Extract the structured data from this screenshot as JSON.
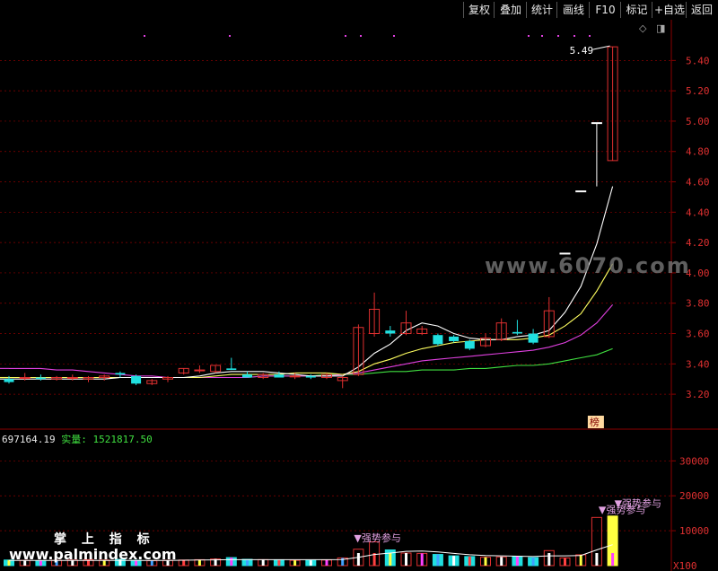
{
  "toolbar": {
    "items": [
      "复权",
      "叠加",
      "统计",
      "画线",
      "F10",
      "标记",
      "+自选",
      "返回"
    ]
  },
  "price_axis": {
    "labels": [
      "5.40",
      "5.20",
      "5.00",
      "4.80",
      "4.60",
      "4.40",
      "4.20",
      "4.00",
      "3.80",
      "3.60",
      "3.40",
      "3.20"
    ],
    "values": [
      5.4,
      5.2,
      5.0,
      4.8,
      4.6,
      4.4,
      4.2,
      4.0,
      3.8,
      3.6,
      3.4,
      3.2
    ]
  },
  "volume_axis": {
    "labels": [
      "30000",
      "20000",
      "10000"
    ],
    "values": [
      30000,
      20000,
      10000
    ],
    "unit_label": "X100"
  },
  "annotations": {
    "high_price": "5.49",
    "rank_tag": "榜",
    "signal_text": "强势参与"
  },
  "volume_header": {
    "value": "697164.19",
    "actual_label": "实量:",
    "actual_value": "1521817.50"
  },
  "watermarks": {
    "site": "www.6070.com",
    "brand": "掌 上 指 标",
    "url": "www.palmindex.com"
  },
  "colors": {
    "up": "#e03030",
    "down": "#20e0e0",
    "ma5": "#ffffff",
    "ma10": "#ffff60",
    "ma20": "#e040e0",
    "ma60": "#40e040",
    "grid": "#8b0000"
  },
  "chart_data": {
    "type": "candlestick",
    "price_ylim": [
      3.1,
      5.55
    ],
    "volume_ylim": [
      0,
      36000
    ],
    "candles": [
      {
        "o": 3.3,
        "h": 3.32,
        "l": 3.27,
        "c": 3.28
      },
      {
        "o": 3.31,
        "h": 3.34,
        "l": 3.29,
        "c": 3.31
      },
      {
        "o": 3.31,
        "h": 3.33,
        "l": 3.29,
        "c": 3.3
      },
      {
        "o": 3.3,
        "h": 3.32,
        "l": 3.29,
        "c": 3.31
      },
      {
        "o": 3.31,
        "h": 3.33,
        "l": 3.29,
        "c": 3.31
      },
      {
        "o": 3.3,
        "h": 3.32,
        "l": 3.28,
        "c": 3.31
      },
      {
        "o": 3.31,
        "h": 3.33,
        "l": 3.29,
        "c": 3.32
      },
      {
        "o": 3.34,
        "h": 3.35,
        "l": 3.31,
        "c": 3.33
      },
      {
        "o": 3.32,
        "h": 3.33,
        "l": 3.26,
        "c": 3.27
      },
      {
        "o": 3.27,
        "h": 3.3,
        "l": 3.26,
        "c": 3.29
      },
      {
        "o": 3.3,
        "h": 3.32,
        "l": 3.28,
        "c": 3.31
      },
      {
        "o": 3.34,
        "h": 3.37,
        "l": 3.33,
        "c": 3.37
      },
      {
        "o": 3.36,
        "h": 3.39,
        "l": 3.34,
        "c": 3.36
      },
      {
        "o": 3.35,
        "h": 3.39,
        "l": 3.34,
        "c": 3.39
      },
      {
        "o": 3.37,
        "h": 3.44,
        "l": 3.36,
        "c": 3.36
      },
      {
        "o": 3.33,
        "h": 3.35,
        "l": 3.31,
        "c": 3.31
      },
      {
        "o": 3.31,
        "h": 3.34,
        "l": 3.3,
        "c": 3.33
      },
      {
        "o": 3.33,
        "h": 3.35,
        "l": 3.31,
        "c": 3.31
      },
      {
        "o": 3.32,
        "h": 3.34,
        "l": 3.3,
        "c": 3.32
      },
      {
        "o": 3.32,
        "h": 3.33,
        "l": 3.3,
        "c": 3.31
      },
      {
        "o": 3.31,
        "h": 3.34,
        "l": 3.3,
        "c": 3.33
      },
      {
        "o": 3.29,
        "h": 3.32,
        "l": 3.24,
        "c": 3.31
      },
      {
        "o": 3.33,
        "h": 3.66,
        "l": 3.32,
        "c": 3.64
      },
      {
        "o": 3.6,
        "h": 3.87,
        "l": 3.58,
        "c": 3.76
      },
      {
        "o": 3.62,
        "h": 3.65,
        "l": 3.58,
        "c": 3.6
      },
      {
        "o": 3.6,
        "h": 3.75,
        "l": 3.59,
        "c": 3.67
      },
      {
        "o": 3.6,
        "h": 3.65,
        "l": 3.59,
        "c": 3.63
      },
      {
        "o": 3.59,
        "h": 3.6,
        "l": 3.52,
        "c": 3.53
      },
      {
        "o": 3.58,
        "h": 3.59,
        "l": 3.54,
        "c": 3.55
      },
      {
        "o": 3.55,
        "h": 3.56,
        "l": 3.49,
        "c": 3.5
      },
      {
        "o": 3.52,
        "h": 3.6,
        "l": 3.51,
        "c": 3.57
      },
      {
        "o": 3.56,
        "h": 3.7,
        "l": 3.55,
        "c": 3.67
      },
      {
        "o": 3.61,
        "h": 3.69,
        "l": 3.59,
        "c": 3.6
      },
      {
        "o": 3.6,
        "h": 3.63,
        "l": 3.53,
        "c": 3.54
      },
      {
        "o": 3.58,
        "h": 3.84,
        "l": 3.57,
        "c": 3.75
      },
      {
        "o": 4.13,
        "h": 4.13,
        "l": 4.13,
        "c": 4.13
      },
      {
        "o": 4.54,
        "h": 4.54,
        "l": 4.54,
        "c": 4.54
      },
      {
        "o": 4.99,
        "h": 4.99,
        "l": 4.57,
        "c": 4.99
      },
      {
        "o": 4.74,
        "h": 5.49,
        "l": 4.74,
        "c": 5.49
      }
    ],
    "ma5": [
      3.3,
      3.3,
      3.3,
      3.3,
      3.3,
      3.3,
      3.3,
      3.31,
      3.31,
      3.31,
      3.31,
      3.31,
      3.32,
      3.34,
      3.35,
      3.35,
      3.35,
      3.34,
      3.33,
      3.32,
      3.32,
      3.32,
      3.38,
      3.47,
      3.53,
      3.62,
      3.67,
      3.65,
      3.6,
      3.57,
      3.56,
      3.56,
      3.58,
      3.59,
      3.62,
      3.74,
      3.91,
      4.19,
      4.57
    ],
    "ma10": [
      3.31,
      3.31,
      3.31,
      3.31,
      3.31,
      3.31,
      3.31,
      3.31,
      3.31,
      3.31,
      3.31,
      3.31,
      3.31,
      3.32,
      3.33,
      3.33,
      3.33,
      3.33,
      3.34,
      3.34,
      3.34,
      3.33,
      3.35,
      3.4,
      3.43,
      3.47,
      3.5,
      3.52,
      3.54,
      3.55,
      3.56,
      3.56,
      3.56,
      3.57,
      3.59,
      3.65,
      3.73,
      3.88,
      4.06
    ],
    "ma20": [
      3.37,
      3.37,
      3.37,
      3.36,
      3.36,
      3.35,
      3.34,
      3.33,
      3.32,
      3.32,
      3.31,
      3.31,
      3.31,
      3.31,
      3.31,
      3.31,
      3.32,
      3.32,
      3.32,
      3.32,
      3.32,
      3.33,
      3.34,
      3.36,
      3.38,
      3.4,
      3.42,
      3.43,
      3.44,
      3.45,
      3.46,
      3.47,
      3.48,
      3.49,
      3.51,
      3.54,
      3.59,
      3.67,
      3.79
    ],
    "ma60": [
      3.31,
      3.31,
      3.31,
      3.31,
      3.31,
      3.31,
      3.31,
      3.31,
      3.31,
      3.31,
      3.31,
      3.31,
      3.31,
      3.31,
      3.31,
      3.31,
      3.32,
      3.32,
      3.32,
      3.32,
      3.33,
      3.33,
      3.33,
      3.34,
      3.35,
      3.35,
      3.36,
      3.36,
      3.36,
      3.37,
      3.37,
      3.38,
      3.39,
      3.39,
      3.4,
      3.42,
      3.44,
      3.46,
      3.5
    ],
    "volume": [
      1600,
      1500,
      1400,
      1500,
      1600,
      1700,
      1600,
      1800,
      1500,
      1400,
      1500,
      1600,
      1700,
      1900,
      2300,
      1800,
      1700,
      1600,
      1500,
      1500,
      1600,
      2200,
      4700,
      6800,
      4500,
      3600,
      3500,
      3200,
      2800,
      2600,
      2400,
      2500,
      2600,
      2300,
      4300,
      2200,
      3100,
      13800,
      14200
    ],
    "volume_ma": [
      1500,
      1500,
      1500,
      1500,
      1500,
      1500,
      1500,
      1500,
      1500,
      1500,
      1500,
      1550,
      1600,
      1650,
      1700,
      1700,
      1700,
      1700,
      1700,
      1700,
      1700,
      1750,
      2400,
      3200,
      3600,
      4100,
      4200,
      3900,
      3500,
      3100,
      2900,
      2800,
      2700,
      2600,
      2800,
      2800,
      2900,
      4500,
      6000
    ]
  }
}
